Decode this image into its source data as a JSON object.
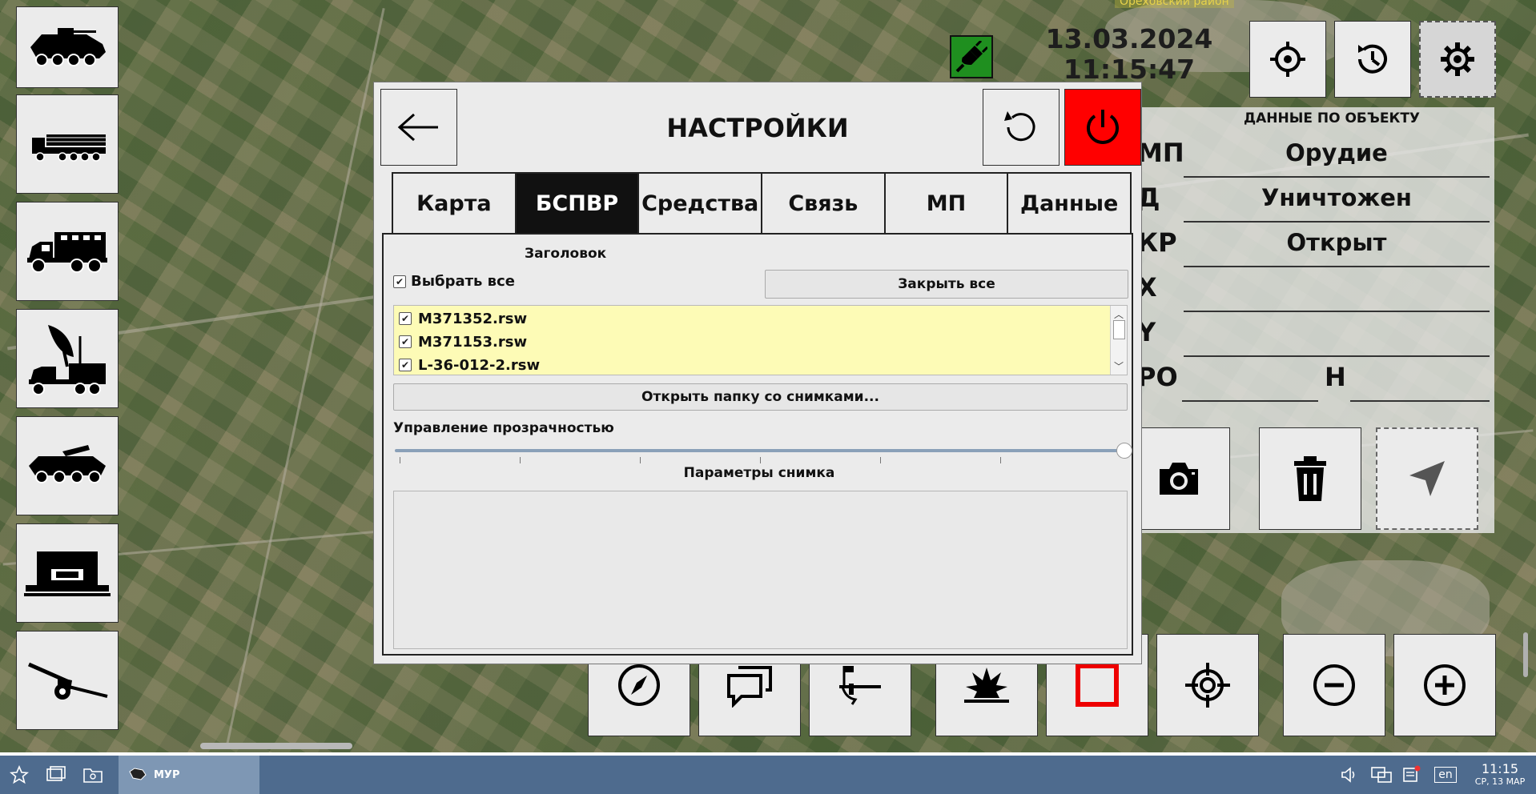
{
  "map": {
    "label": "Ореховский район"
  },
  "datetime": {
    "date": "13.03.2024",
    "time": "11:15:47"
  },
  "top_buttons": {
    "target_icon": "crosshair-icon",
    "history_icon": "history-icon",
    "settings_icon": "gear-icon"
  },
  "object_panel": {
    "title": "ДАННЫЕ ПО ОБЪЕКТУ",
    "rows": [
      {
        "key": "МП",
        "value": "Орудие"
      },
      {
        "key": "Д",
        "value": "Уничтожен"
      },
      {
        "key": "КР",
        "value": "Открыт"
      },
      {
        "key": "Х",
        "value": ""
      },
      {
        "key": "Y",
        "value": ""
      },
      {
        "key": "РО",
        "value": "",
        "extra_key": "Н",
        "extra_value": ""
      }
    ]
  },
  "settings": {
    "title": "НАСТРОЙКИ",
    "tabs": [
      {
        "label": "Карта",
        "active": false
      },
      {
        "label": "БСПВР",
        "active": true
      },
      {
        "label": "Средства",
        "active": false
      },
      {
        "label": "Связь",
        "active": false
      },
      {
        "label": "МП",
        "active": false
      },
      {
        "label": "Данные",
        "active": false
      }
    ],
    "header": "Заголовок",
    "select_all": {
      "label": "Выбрать все",
      "checked": true
    },
    "close_all": "Закрыть все",
    "files": [
      {
        "name": "M371352.rsw",
        "checked": true
      },
      {
        "name": "M371153.rsw",
        "checked": true
      },
      {
        "name": "L-36-012-2.rsw",
        "checked": true
      }
    ],
    "open_folder": "Открыть папку со снимками...",
    "transparency_label": "Управление прозрачностью",
    "transparency_value": 1.0,
    "image_params": "Параметры снимка"
  },
  "taskbar": {
    "app_label": "МУР",
    "lang": "en",
    "time": "11:15",
    "date": "СР, 13 МАР"
  },
  "colors": {
    "power": "#ff0000",
    "plug": "#1f8f1f",
    "taskbar": "#4e6b8e",
    "file_list_bg": "#fdfbb6",
    "active_tab": "#111111"
  }
}
